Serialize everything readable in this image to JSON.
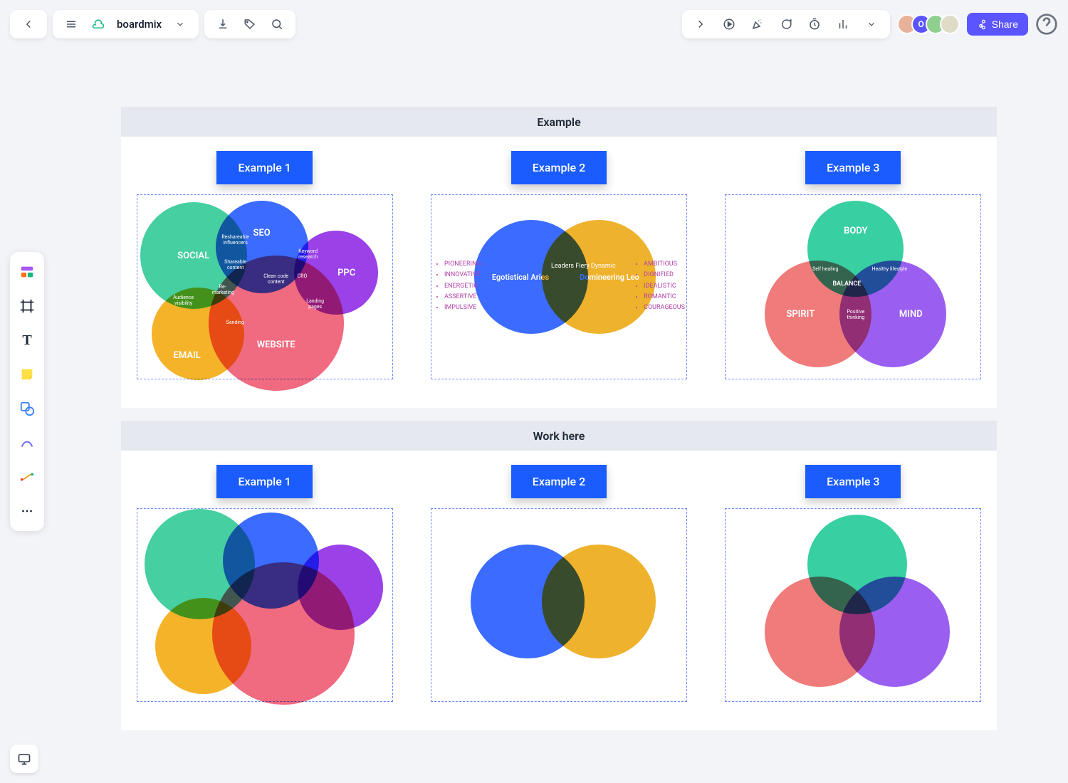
{
  "header": {
    "doc_title": "boardmix",
    "share_label": "Share"
  },
  "avatars": [
    "",
    "O",
    "",
    ""
  ],
  "sections": {
    "example_title": "Example",
    "workhere_title": "Work here",
    "labels": {
      "e1": "Example 1",
      "e2": "Example 2",
      "e3": "Example 3"
    }
  },
  "venn1": {
    "social": "SOCIAL",
    "seo": "SEO",
    "ppc": "PPC",
    "email": "EMAIL",
    "website": "WEBSITE",
    "center": "Clean code content",
    "t_reshare": "Reshareable influencers",
    "t_share": "Shareable content",
    "t_keyword": "Keyword research",
    "t_cro": "CRO",
    "t_landing": "Landing pages",
    "t_remarket": "Re-marketing",
    "t_audience": "Audience visibility",
    "t_sending": "Sending"
  },
  "venn2": {
    "left": "Egotistical Aries",
    "right": "Domineering Leo",
    "overlap": "Leaders\nFiery\nDynamic",
    "left_bullets": [
      "PIONEERING",
      "INNOVATIVE",
      "ENERGETIC",
      "ASSERTIVE",
      "IMPULSIVE"
    ],
    "right_bullets": [
      "AMBITIOUS",
      "DIGNIFIED",
      "IDEALISTIC",
      "ROMANTIC",
      "COURAGEOUS"
    ]
  },
  "venn3": {
    "top": "BODY",
    "left": "SPIRIT",
    "right": "MIND",
    "center": "BALANCE",
    "t_self_healing": "Self healing",
    "t_healthy": "Healthy lifestyle",
    "t_positive": "Positive thinking"
  }
}
